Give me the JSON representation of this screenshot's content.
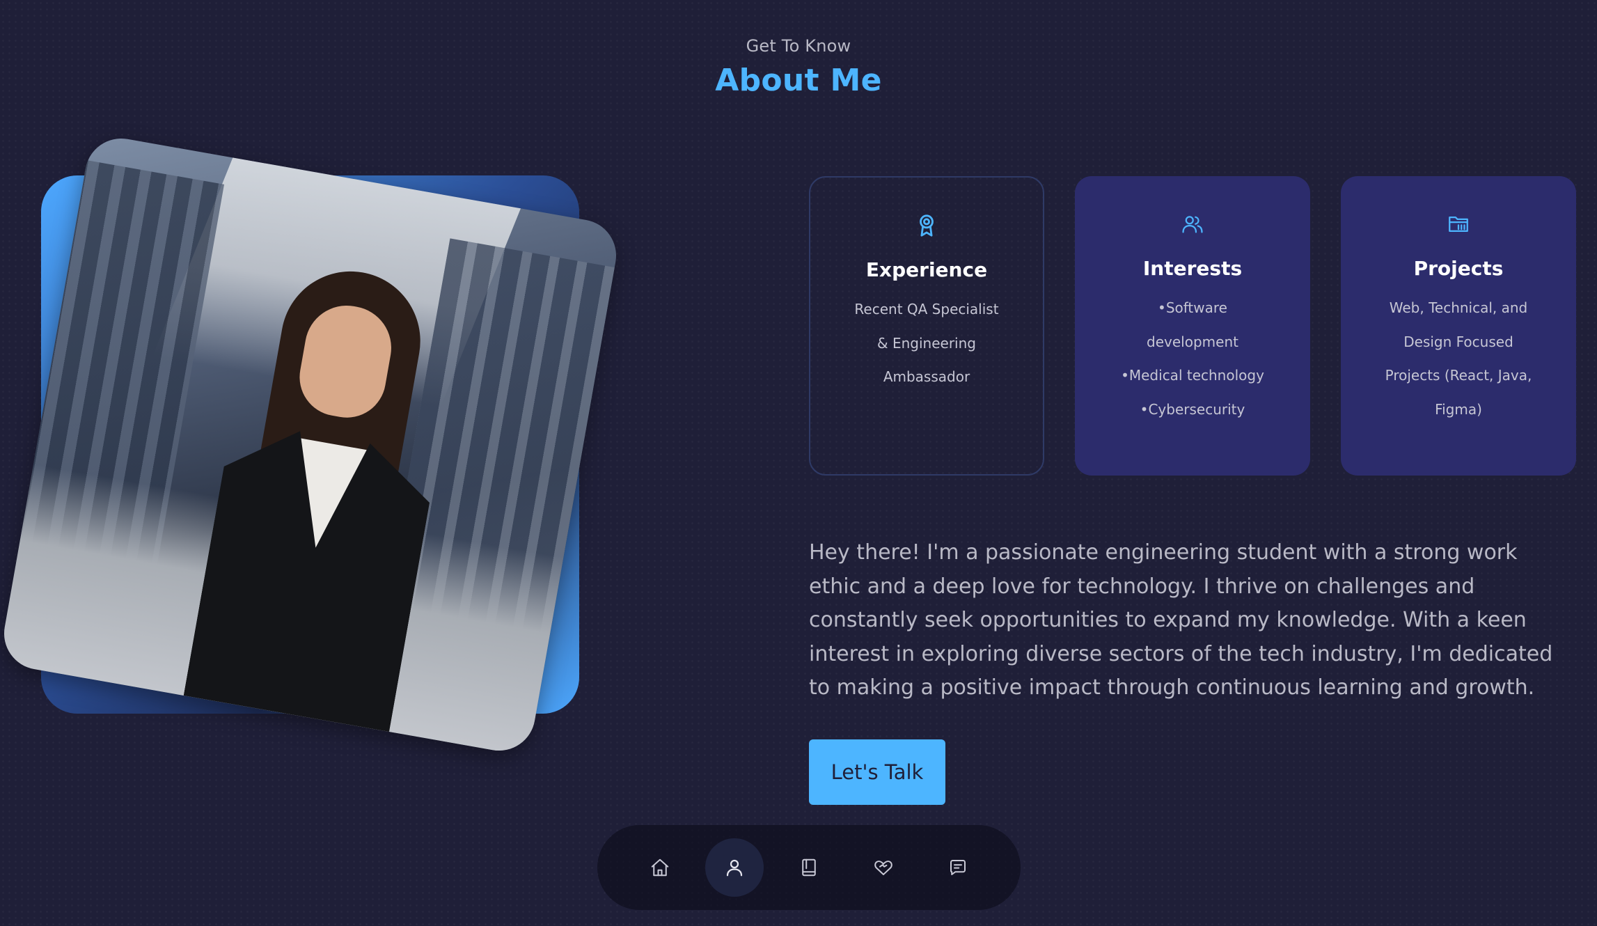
{
  "header": {
    "subtitle": "Get To Know",
    "title": "About Me"
  },
  "photo": {
    "alt": "Portrait photo"
  },
  "cards": [
    {
      "icon": "award-icon",
      "title": "Experience",
      "lines": [
        "Recent QA Specialist",
        "& Engineering",
        "Ambassador"
      ]
    },
    {
      "icon": "users-icon",
      "title": "Interests",
      "lines": [
        "•Software",
        "development",
        "•Medical technology",
        "•Cybersecurity"
      ]
    },
    {
      "icon": "folder-icon",
      "title": "Projects",
      "lines": [
        "Web, Technical, and",
        "Design Focused",
        "Projects (React, Java,",
        "Figma)"
      ]
    }
  ],
  "about": {
    "paragraph": "Hey there! I'm a passionate engineering student with a strong work ethic and a deep love for technology. I thrive on challenges and constantly seek opportunities to expand my knowledge. With a keen interest in exploring diverse sectors of the tech industry, I'm dedicated to making a positive impact through continuous learning and growth."
  },
  "cta": {
    "label": "Let's Talk"
  },
  "nav": {
    "items": [
      {
        "name": "home",
        "icon": "home-icon",
        "active": false
      },
      {
        "name": "about",
        "icon": "user-icon",
        "active": true
      },
      {
        "name": "experience",
        "icon": "book-icon",
        "active": false
      },
      {
        "name": "services",
        "icon": "heart-handshake-icon",
        "active": false
      },
      {
        "name": "contact",
        "icon": "message-icon",
        "active": false
      }
    ]
  },
  "colors": {
    "background": "#1f1f38",
    "accent": "#4db5ff",
    "card": "#2c2c6c"
  }
}
